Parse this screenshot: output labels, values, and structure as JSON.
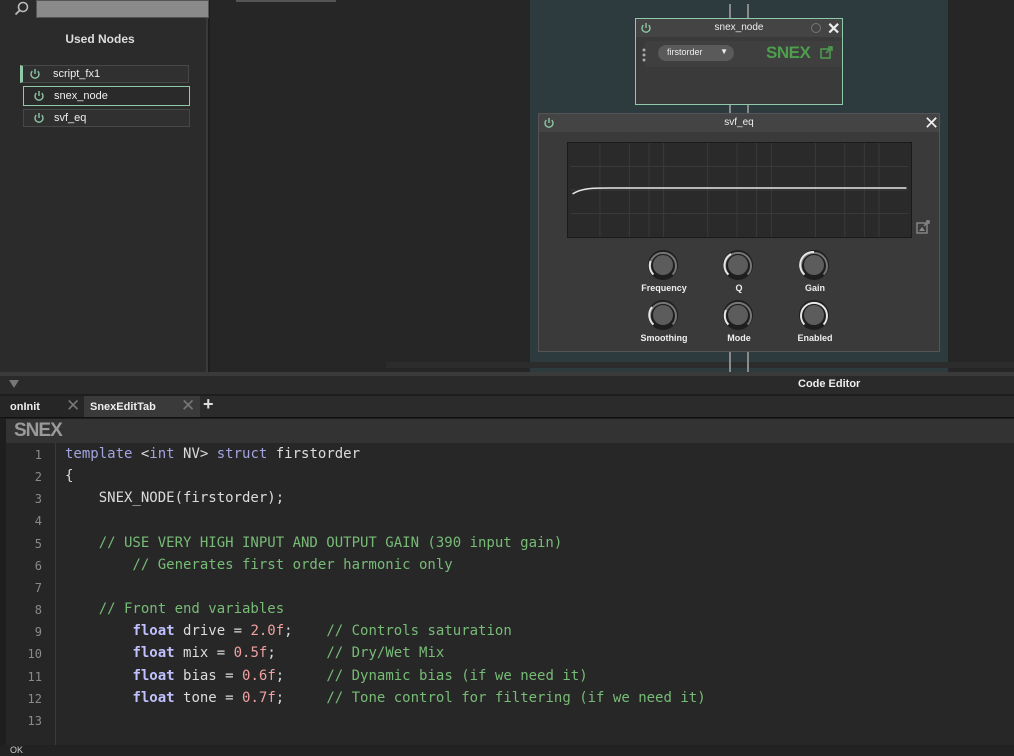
{
  "left_panel": {
    "title": "Used Nodes",
    "nodes": [
      {
        "label": "script_fx1"
      },
      {
        "label": "snex_node"
      },
      {
        "label": "svf_eq"
      }
    ]
  },
  "snex_node": {
    "title": "snex_node",
    "selected_class": "firstorder",
    "logo": "SNEX"
  },
  "svf_eq": {
    "title": "svf_eq",
    "knobs": [
      {
        "label": "Frequency"
      },
      {
        "label": "Q"
      },
      {
        "label": "Gain"
      },
      {
        "label": "Smoothing"
      },
      {
        "label": "Mode"
      },
      {
        "label": "Enabled"
      }
    ]
  },
  "editor": {
    "title": "Code Editor",
    "tabs": [
      {
        "label": "onInit"
      },
      {
        "label": "SnexEditTab"
      }
    ],
    "add_tab": "+",
    "strip_logo": "SNEX"
  },
  "code": {
    "line_numbers": [
      "1",
      "2",
      "3",
      "4",
      "5",
      "6",
      "7",
      "8",
      "9",
      "10",
      "11",
      "12",
      "13"
    ],
    "l1": {
      "kw1": "template",
      "a": " <",
      "kw2": "int",
      "b": " NV> ",
      "kw3": "struct",
      "c": " firstorder"
    },
    "l2": "{",
    "l3": "    SNEX_NODE(firstorder);",
    "l5": "    // USE VERY HIGH INPUT AND OUTPUT GAIN (390 input gain)",
    "l6": "        // Generates first order harmonic only",
    "l8": "    // Front end variables",
    "vars": [
      {
        "kw": "float",
        "name": " drive = ",
        "val": "2.0f",
        "pad": ";    ",
        "comment": "// Controls saturation"
      },
      {
        "kw": "float",
        "name": " mix = ",
        "val": "0.5f",
        "pad": ";      ",
        "comment": "// Dry/Wet Mix"
      },
      {
        "kw": "float",
        "name": " bias = ",
        "val": "0.6f",
        "pad": ";     ",
        "comment": "// Dynamic bias (if we need it)"
      },
      {
        "kw": "float",
        "name": " tone = ",
        "val": "0.7f",
        "pad": ";     ",
        "comment": "// Tone control for filtering (if we need it)"
      }
    ]
  },
  "status": "OK"
}
